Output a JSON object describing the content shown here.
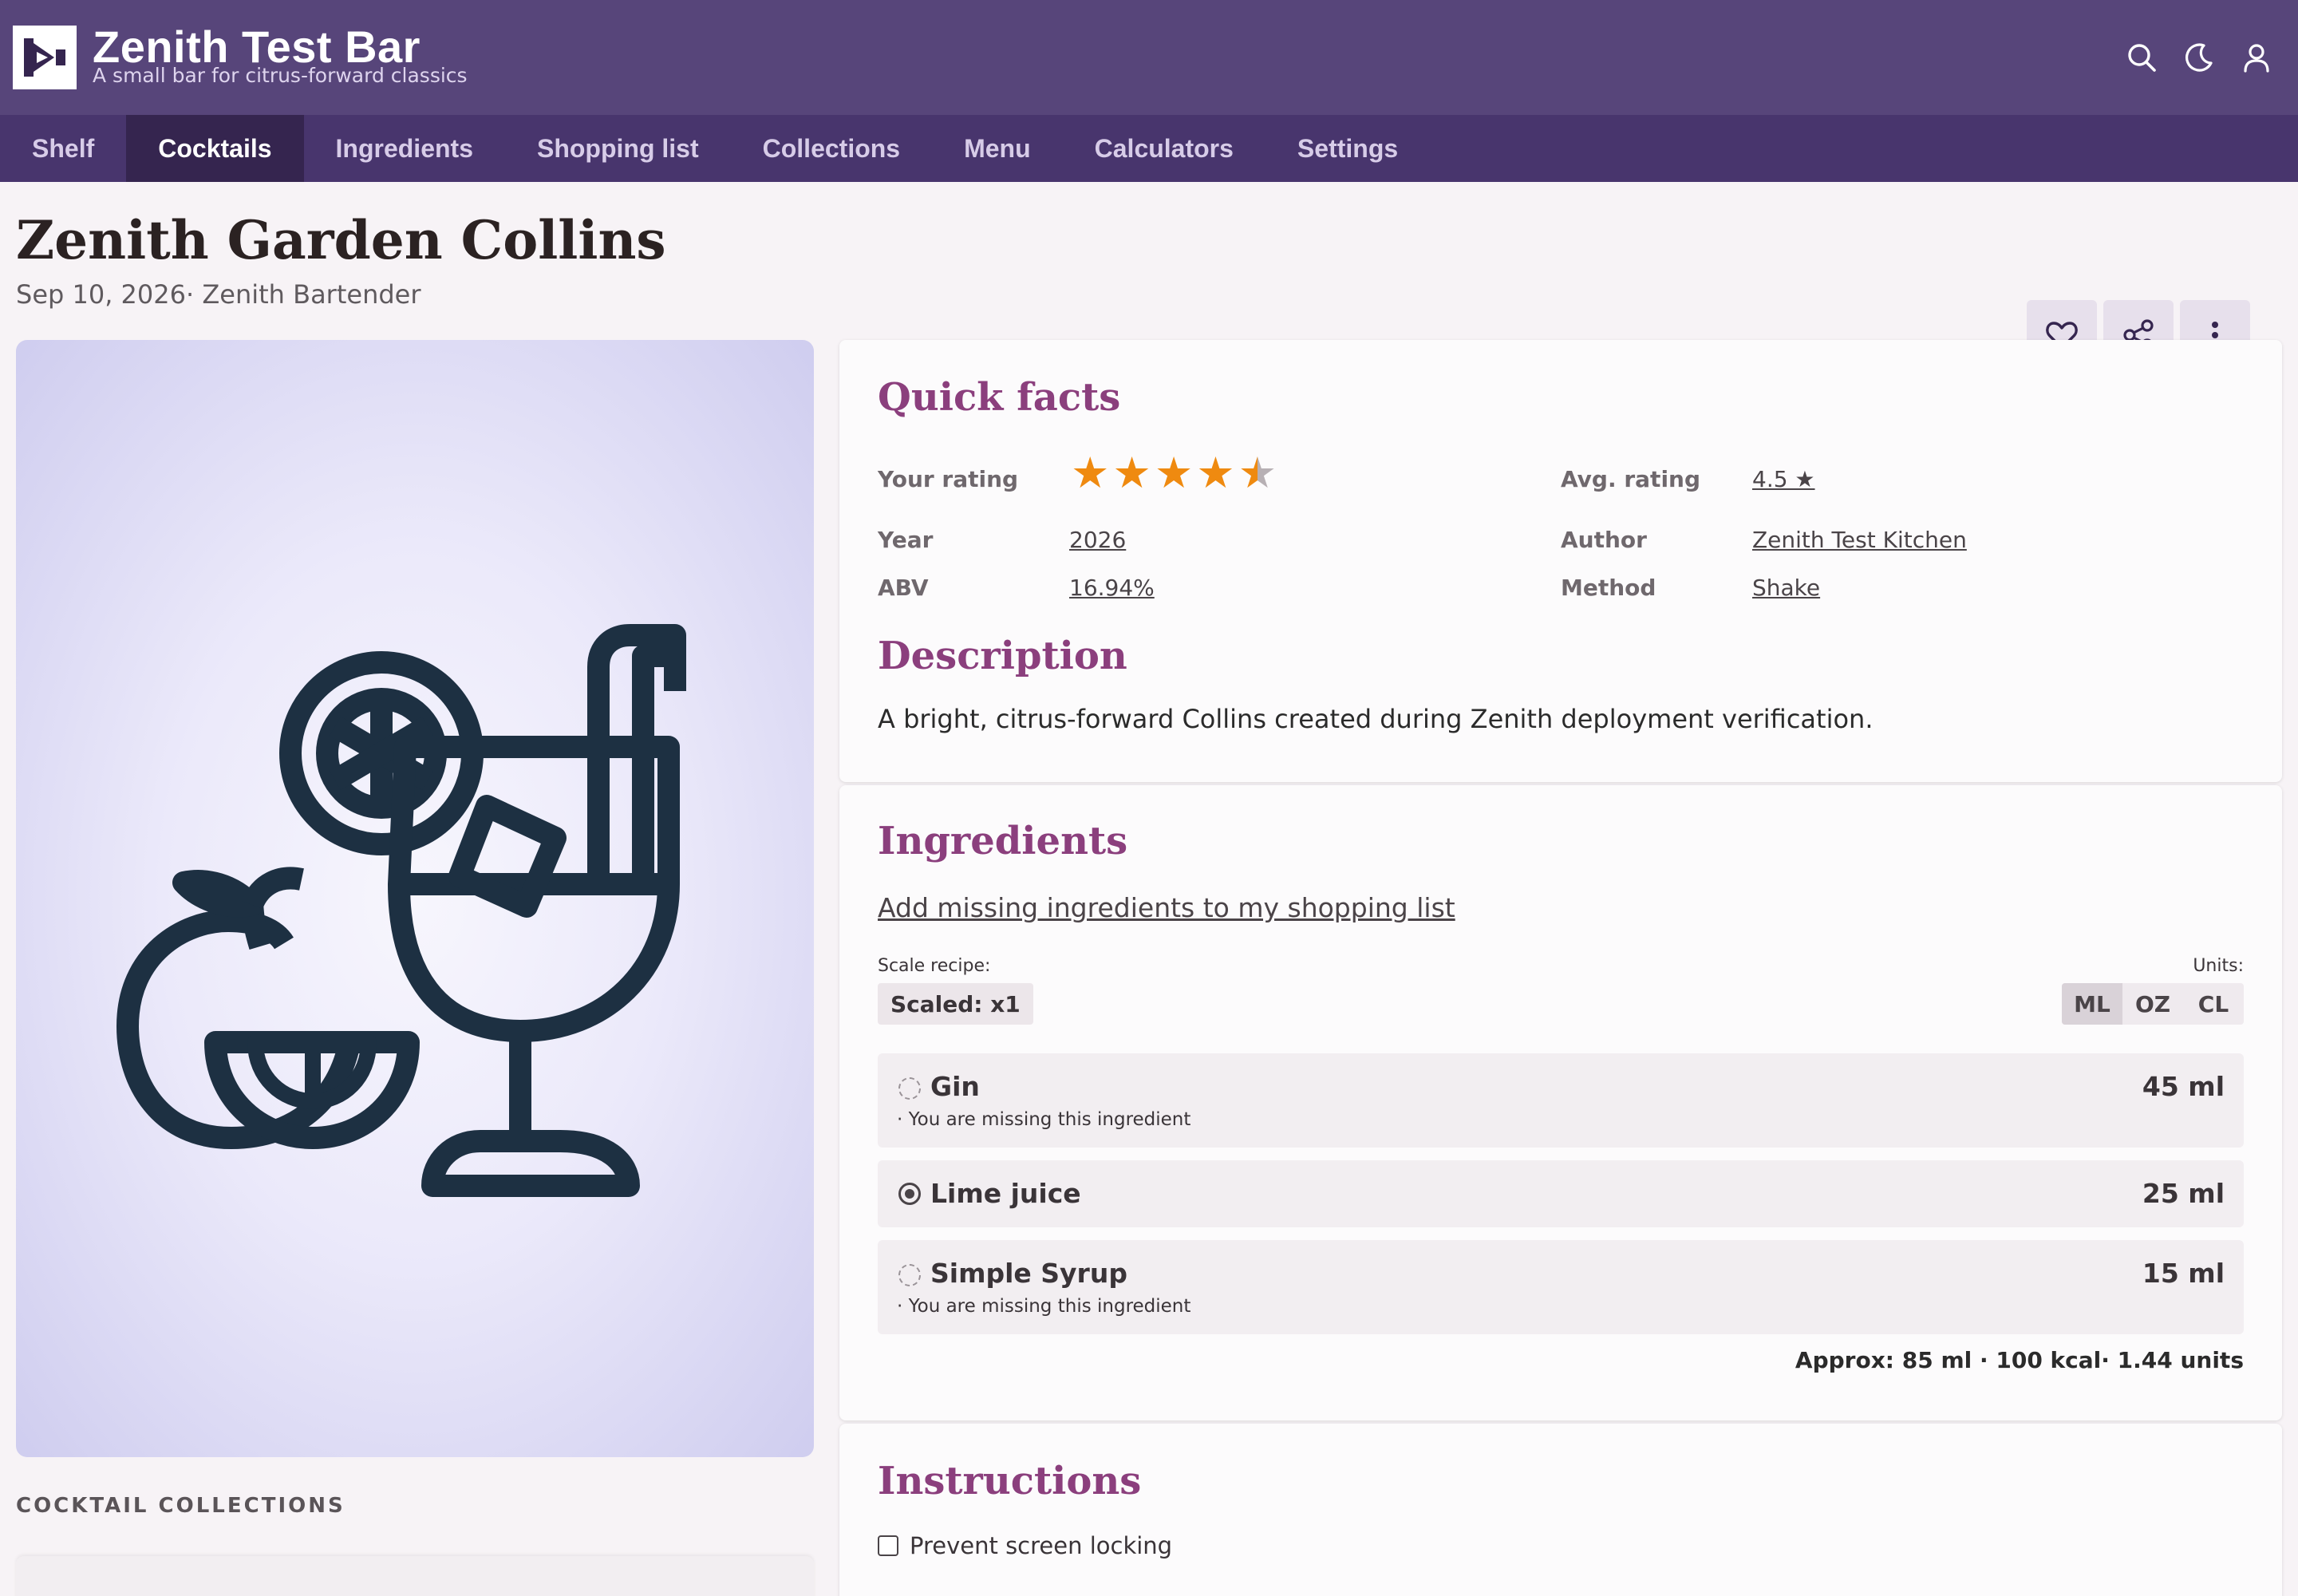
{
  "header": {
    "title": "Zenith Test Bar",
    "subtitle": "A small bar for citrus-forward classics",
    "icons": [
      "search-icon",
      "moon-icon",
      "user-icon"
    ]
  },
  "nav": {
    "items": [
      {
        "label": "Shelf",
        "active": false
      },
      {
        "label": "Cocktails",
        "active": true
      },
      {
        "label": "Ingredients",
        "active": false
      },
      {
        "label": "Shopping list",
        "active": false
      },
      {
        "label": "Collections",
        "active": false
      },
      {
        "label": "Menu",
        "active": false
      },
      {
        "label": "Calculators",
        "active": false
      },
      {
        "label": "Settings",
        "active": false
      }
    ]
  },
  "cocktail": {
    "name": "Zenith Garden Collins",
    "meta": "Sep 10, 2026· Zenith Bartender",
    "actions": [
      "heart-icon",
      "share-icon",
      "more-vertical-icon"
    ]
  },
  "collections": {
    "heading": "COCKTAIL COLLECTIONS"
  },
  "facts": {
    "title": "Quick facts",
    "your_rating_label": "Your rating",
    "your_rating_value": 4.5,
    "your_rating_max": 5,
    "avg_rating_label": "Avg. rating",
    "avg_rating_value": "4.5 ★",
    "year_label": "Year",
    "year_value": "2026",
    "author_label": "Author",
    "author_value": "Zenith Test Kitchen",
    "abv_label": "ABV",
    "abv_value": "16.94%",
    "method_label": "Method",
    "method_value": "Shake"
  },
  "description": {
    "title": "Description",
    "text": "A bright, citrus-forward Collins created during Zenith deployment verification."
  },
  "ingredients": {
    "title": "Ingredients",
    "add_missing": "Add missing ingredients to my shopping list",
    "scale_label": "Scale recipe:",
    "scale_value": "Scaled: x1",
    "units_label": "Units:",
    "units": [
      {
        "label": "ML",
        "active": true
      },
      {
        "label": "OZ",
        "active": false
      },
      {
        "label": "CL",
        "active": false
      }
    ],
    "items": [
      {
        "name": "Gin",
        "amount": "45 ml",
        "note": "· You are missing this ingredient",
        "status": "missing"
      },
      {
        "name": "Lime juice",
        "amount": "25 ml",
        "note": "",
        "status": "have"
      },
      {
        "name": "Simple Syrup",
        "amount": "15 ml",
        "note": "· You are missing this ingredient",
        "status": "missing"
      }
    ],
    "approx": "Approx: 85 ml · 100 kcal· 1.44 units"
  },
  "instructions": {
    "title": "Instructions",
    "prevent_lock_label": "Prevent screen locking",
    "prevent_lock_checked": false
  },
  "colors": {
    "header_bg": "#57457a",
    "nav_bg": "#48356d",
    "nav_active_bg": "#35254f",
    "section_title": "#8b3f7d",
    "star": "#ef8a10",
    "illustration": "#1d3042"
  }
}
